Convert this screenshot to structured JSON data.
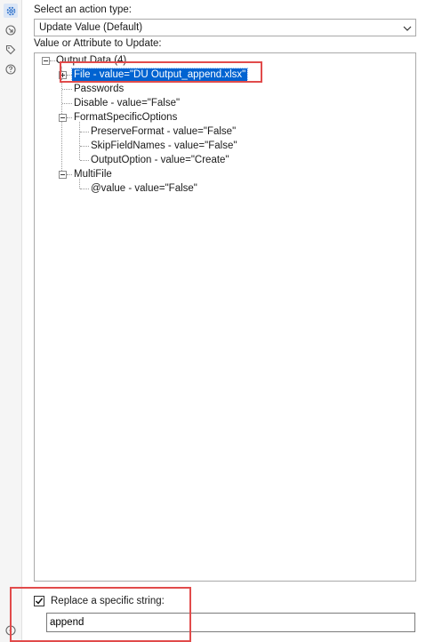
{
  "sidebar": {
    "icons": [
      {
        "name": "gear-icon",
        "active": true
      },
      {
        "name": "arrow-circle-icon",
        "active": false
      },
      {
        "name": "tag-icon",
        "active": false
      },
      {
        "name": "help-icon",
        "active": false
      }
    ]
  },
  "action": {
    "label": "Select an action type:",
    "selected": "Update Value (Default)"
  },
  "tree": {
    "label": "Value or Attribute to Update:",
    "root": "Output Data (4)",
    "file": "File - value=\"DU Output_append.xlsx\"",
    "passwords": "Passwords",
    "disable": "Disable - value=\"False\"",
    "format_options": "FormatSpecificOptions",
    "preserve_format": "PreserveFormat - value=\"False\"",
    "skip_field_names": "SkipFieldNames - value=\"False\"",
    "output_option": "OutputOption - value=\"Create\"",
    "multifile": "MultiFile",
    "multifile_value": "@value - value=\"False\""
  },
  "replace": {
    "checked": true,
    "label": "Replace a specific string:",
    "value": "append"
  },
  "colors": {
    "selection": "#0063d1",
    "highlight_border": "#e14b4b"
  }
}
